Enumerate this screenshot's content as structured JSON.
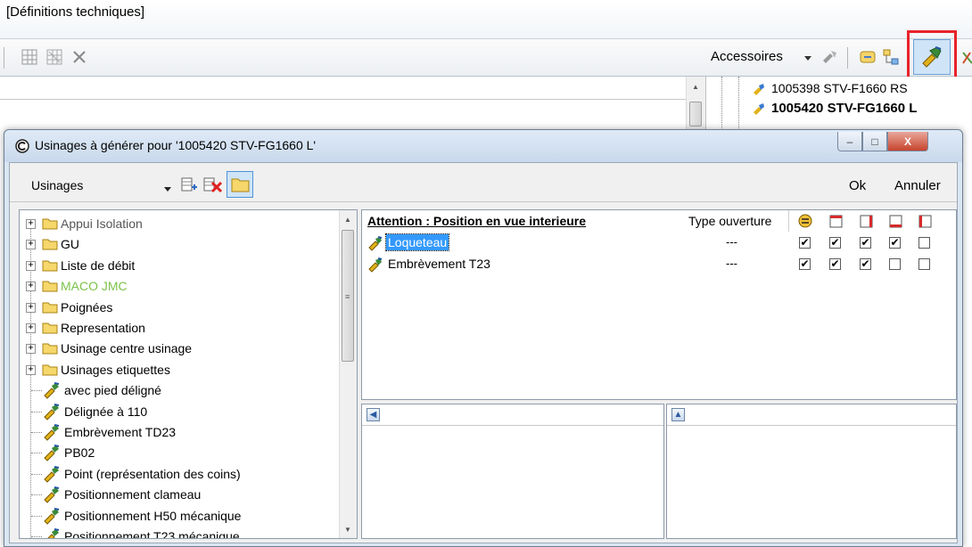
{
  "colors": {
    "dialog_frame": "#dbe6f3",
    "selection": "#3399ff",
    "highlight_box": "#e8232a",
    "maco_jmc_text": "#7cc24a"
  },
  "background_app": {
    "title": "[Définitions techniques]",
    "toolbar": {
      "left_icons": [
        "grid-tool-icon",
        "grid-tool-2-icon",
        "delete-icon"
      ],
      "accessories_label": "Accessoires",
      "right_icons": [
        "dropdown-arrow-icon",
        "accessory-tool-icon",
        "link-icon",
        "tree-icon",
        "generate-machining-icon",
        "delete-red-icon"
      ]
    },
    "right_tree": [
      {
        "label": "1005398 STV-F1660 RS",
        "bold": false
      },
      {
        "label": "1005420 STV-FG1660 L",
        "bold": true
      }
    ]
  },
  "dialog": {
    "title": "Usinages à générer pour '1005420 STV-FG1660 L'",
    "window_buttons": {
      "minimize": "–",
      "maximize": "□",
      "close": "X"
    },
    "toolbar": {
      "combo_value": "Usinages",
      "ok_label": "Ok",
      "cancel_label": "Annuler"
    },
    "tree": {
      "folders": [
        {
          "label": "Appui Isolation",
          "expander": "+"
        },
        {
          "label": "GU",
          "expander": "+"
        },
        {
          "label": "Liste de débit",
          "expander": "+"
        },
        {
          "label": "MACO JMC",
          "expander": "+"
        },
        {
          "label": "Poignées",
          "expander": "+"
        },
        {
          "label": "Representation",
          "expander": "+"
        },
        {
          "label": "Usinage centre usinage",
          "expander": "+"
        },
        {
          "label": "Usinages etiquettes",
          "expander": "+"
        }
      ],
      "items": [
        {
          "label": "avec pied déligné"
        },
        {
          "label": "Délignée à 110"
        },
        {
          "label": "Embrèvement TD23"
        },
        {
          "label": "PB02"
        },
        {
          "label": "Point (représentation des coins)"
        },
        {
          "label": "Positionnement clameau"
        },
        {
          "label": "Positionnement H50 mécanique"
        },
        {
          "label": "Positionnement T23 mécanique"
        }
      ]
    },
    "list": {
      "title": "Attention : Position en vue interieure",
      "type_col": "Type ouverture",
      "rows": [
        {
          "label": "Loqueteau",
          "type": "---",
          "checks": [
            "✔",
            "✔",
            "✔",
            "✔",
            ""
          ],
          "selected": true
        },
        {
          "label": "Embrèvement T23",
          "type": "---",
          "checks": [
            "✔",
            "✔",
            "✔",
            "",
            ""
          ],
          "selected": false
        }
      ]
    }
  }
}
